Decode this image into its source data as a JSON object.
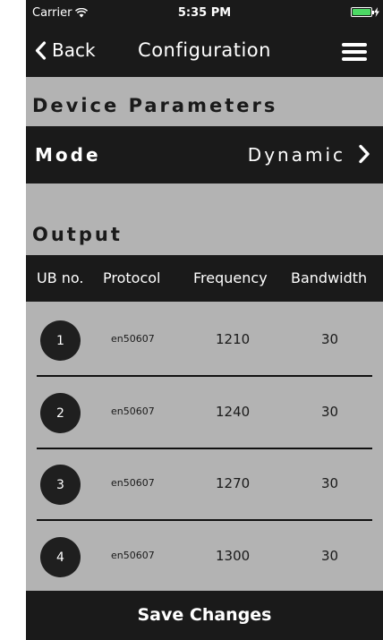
{
  "status_bar": {
    "carrier": "Carrier",
    "time": "5:35 PM"
  },
  "nav": {
    "back_label": "Back",
    "title": "Configuration"
  },
  "device_parameters": {
    "title": "Device Parameters",
    "mode_label": "Mode",
    "mode_value": "Dynamic"
  },
  "output": {
    "title": "Output",
    "columns": [
      "UB no.",
      "Protocol",
      "Frequency",
      "Bandwidth"
    ],
    "rows": [
      {
        "ub": "1",
        "protocol": "en50607",
        "frequency": "1210",
        "bandwidth": "30"
      },
      {
        "ub": "2",
        "protocol": "en50607",
        "frequency": "1240",
        "bandwidth": "30"
      },
      {
        "ub": "3",
        "protocol": "en50607",
        "frequency": "1270",
        "bandwidth": "30"
      },
      {
        "ub": "4",
        "protocol": "en50607",
        "frequency": "1300",
        "bandwidth": "30"
      }
    ]
  },
  "footer": {
    "save_label": "Save Changes"
  },
  "colors": {
    "bar_bg": "#1a1a1a",
    "page_bg": "#b3b3b3",
    "battery": "#4cd964"
  }
}
